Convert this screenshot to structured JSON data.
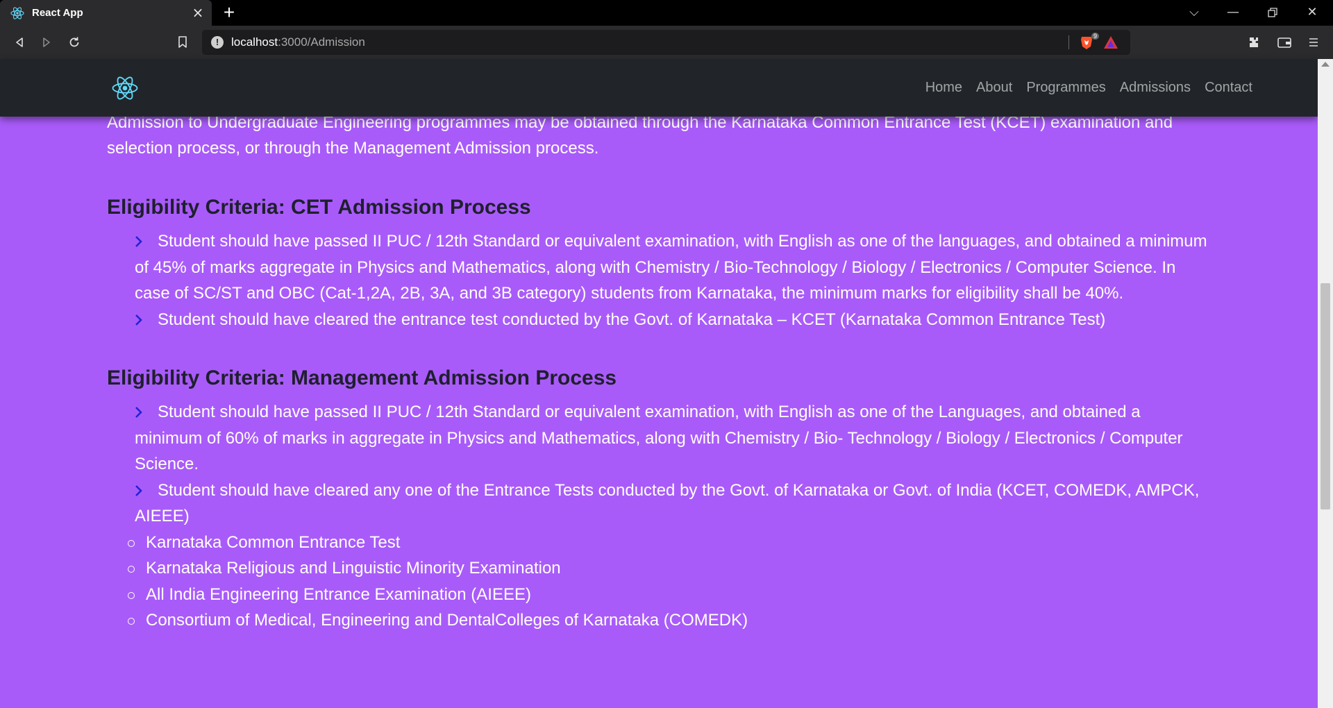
{
  "browser": {
    "tab_title": "React App",
    "url_host": "localhost",
    "url_path": ":3000/Admission",
    "shield_count": "9"
  },
  "navbar": {
    "links": [
      "Home",
      "About",
      "Programmes",
      "Admissions",
      "Contact"
    ]
  },
  "content": {
    "intro": "Admission to Undergraduate Engineering programmes may be obtained through the Karnataka Common Entrance Test (KCET) examination and selection process, or through the Management Admission process.",
    "cet": {
      "title": "Eligibility Criteria: CET Admission Process",
      "items": [
        "Student should have passed II PUC / 12th Standard or equivalent examination, with English as one of the languages, and obtained a minimum of 45% of marks aggregate in Physics and Mathematics, along with Chemistry / Bio-Technology / Biology / Electronics / Computer Science. In case of SC/ST and OBC (Cat-1,2A, 2B, 3A, and 3B category) students from Karnataka, the minimum marks for eligibility shall be 40%.",
        "Student should have cleared the entrance test conducted by the Govt. of Karnataka – KCET (Karnataka Common Entrance Test)"
      ]
    },
    "management": {
      "title": "Eligibility Criteria: Management Admission Process",
      "items": [
        "Student should have passed II PUC / 12th Standard or equivalent examination, with English as one of the Languages, and obtained a minimum of 60% of marks in aggregate in Physics and Mathematics, along with Chemistry / Bio- Technology / Biology / Electronics / Computer Science.",
        "Student should have cleared any one of the Entrance Tests conducted by the Govt. of Karnataka or Govt. of India (KCET, COMEDK, AMPCK, AIEEE)"
      ],
      "sub_items": [
        "Karnataka Common Entrance Test",
        "Karnataka Religious and Linguistic Minority Examination",
        "All India Engineering Entrance Examination (AIEEE)",
        "Consortium of Medical, Engineering and DentalColleges of Karnataka (COMEDK)"
      ]
    }
  },
  "colors": {
    "page_background": "#a95bf9",
    "navbar_background": "#212529",
    "heading_text": "#1f1f2e",
    "chevron": "#2222d6",
    "react_logo": "#61dafb"
  },
  "icons": [
    "react-logo-icon",
    "close-icon",
    "plus-icon",
    "back-icon",
    "forward-icon",
    "reload-icon",
    "bookmark-icon",
    "info-icon",
    "brave-shield-icon",
    "brave-rewards-icon",
    "extensions-icon",
    "wallet-icon",
    "menu-icon",
    "chevron-right-icon"
  ]
}
